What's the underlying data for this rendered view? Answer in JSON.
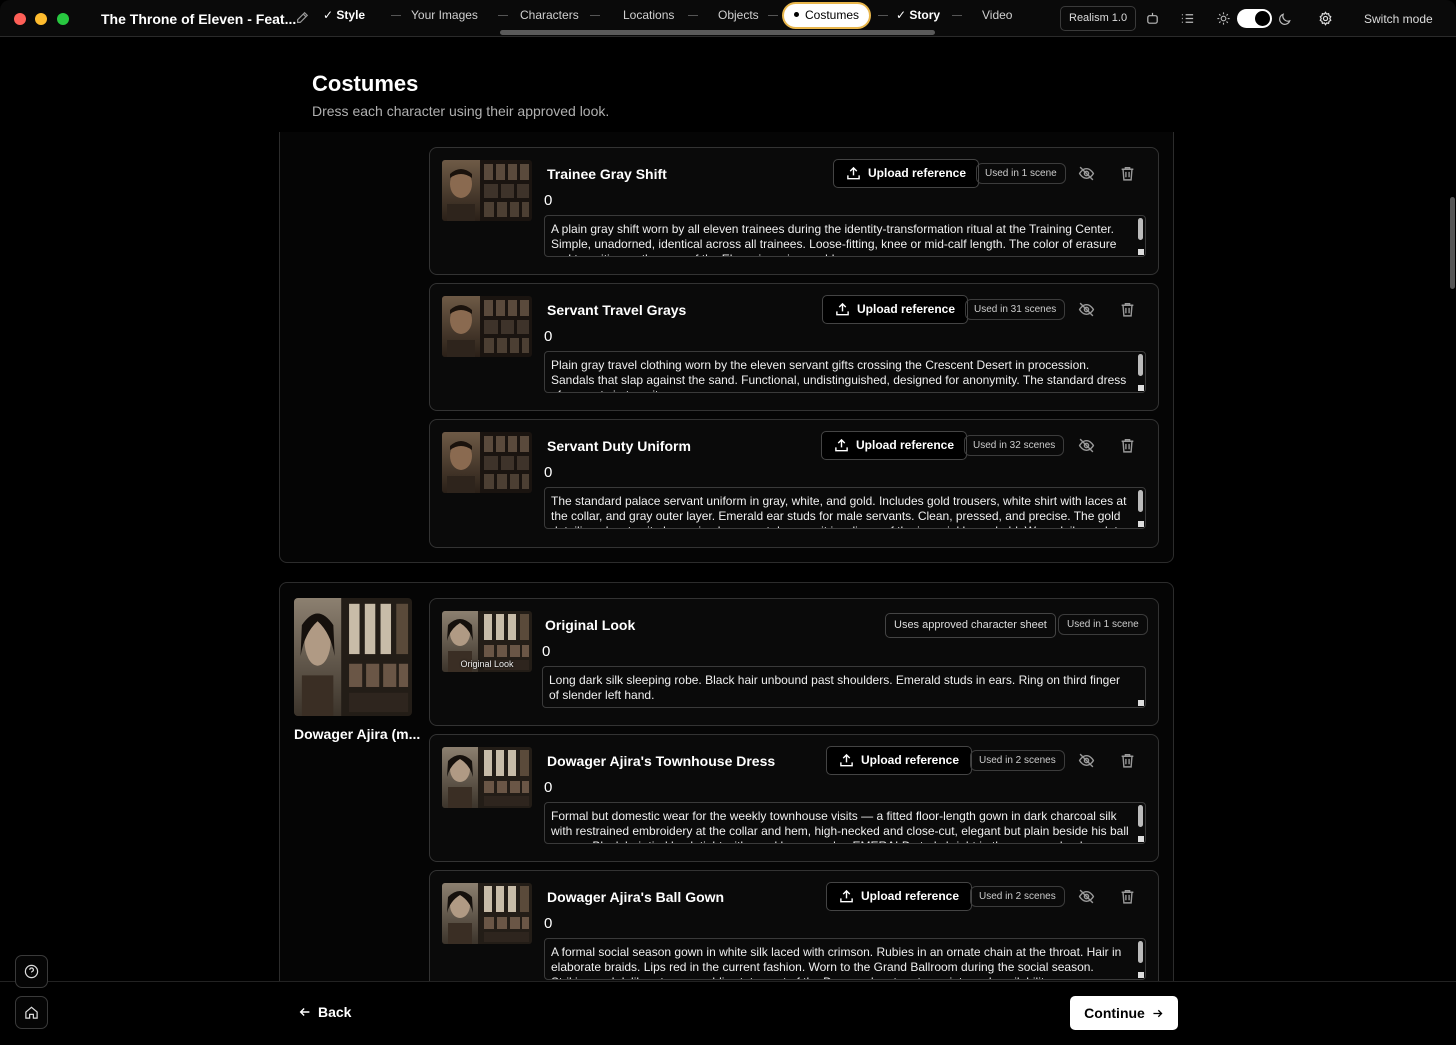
{
  "window": {
    "project_title": "The Throne of Eleven - Feat...",
    "tabs": [
      {
        "label": "Style",
        "state": "done"
      },
      {
        "label": "Your Images",
        "state": "pending"
      },
      {
        "label": "Characters",
        "state": "pending"
      },
      {
        "label": "Locations",
        "state": "pending"
      },
      {
        "label": "Objects",
        "state": "pending"
      },
      {
        "label": "Costumes",
        "state": "active"
      },
      {
        "label": "Story",
        "state": "done"
      },
      {
        "label": "Video",
        "state": "pending"
      }
    ],
    "realism_badge": "Realism 1.0",
    "switch_mode_label": "Switch mode",
    "accent_color": "#e8b64c"
  },
  "page": {
    "title": "Costumes",
    "subtitle": "Dress each character using their approved look."
  },
  "groups": [
    {
      "character_name": "",
      "costumes": [
        {
          "title": "Trainee Gray Shift",
          "count": "0",
          "upload_label": "Upload reference",
          "usage": "Used in 1 scene",
          "description": "A plain gray shift worn by all eleven trainees during the identity-transformation ritual at the Training Center. Simple, unadorned, identical across all trainees. Loose-fitting, knee or mid-calf length. The color of erasure and transition — the gray of the Eleveni service world."
        },
        {
          "title": "Servant Travel Grays",
          "count": "0",
          "upload_label": "Upload reference",
          "usage": "Used in 31 scenes",
          "description": "Plain gray travel clothing worn by the eleven servant gifts crossing the Crescent Desert in procession. Sandals that slap against the sand. Functional, undistinguished, designed for anonymity. The standard dress of servants in transit."
        },
        {
          "title": "Servant Duty Uniform",
          "count": "0",
          "upload_label": "Upload reference",
          "usage": "Used in 32 scenes",
          "description": "The standard palace servant uniform in gray, white, and gold. Includes gold trousers, white shirt with laces at the collar, and gray outer layer. Emerald ear studs for male servants. Clean, pressed, and precise. The gold detailing elevates it above simple servant dress — it is a livery of the imperial household. Worn daily on duty."
        }
      ]
    },
    {
      "character_name": "Dowager Ajira (m...",
      "costumes": [
        {
          "title": "Original Look",
          "thumb_caption": "Original Look",
          "count": "0",
          "approved_label": "Uses approved character sheet",
          "usage": "Used in 1 scene",
          "description": "Long dark silk sleeping robe. Black hair unbound past shoulders. Emerald studs in ears. Ring on third finger of slender left hand."
        },
        {
          "title": "Dowager Ajira's Townhouse Dress",
          "count": "0",
          "upload_label": "Upload reference",
          "usage": "Used in 2 scenes",
          "description": "Formal but domestic wear for the weekly townhouse visits — a fitted floor-length gown in dark charcoal silk with restrained embroidery at the collar and hem, high-necked and close-cut, elegant but plain beside his ball gowns. Black hair tied back tight with pearl bone combs. EMERALD studs bright in the ears — clearly green. A"
        },
        {
          "title": "Dowager Ajira's Ball Gown",
          "count": "0",
          "upload_label": "Upload reference",
          "usage": "Used in 2 scenes",
          "description": "A formal social season gown in white silk laced with crimson. Rubies in an ornate chain at the throat. Hair in elaborate braids. Lips red in the current fashion. Worn to the Grand Ballroom during the social season. Striking and deliberate — a public statement of the Dowager's return to society and availability."
        }
      ]
    }
  ],
  "footer": {
    "back_label": "Back",
    "continue_label": "Continue"
  }
}
